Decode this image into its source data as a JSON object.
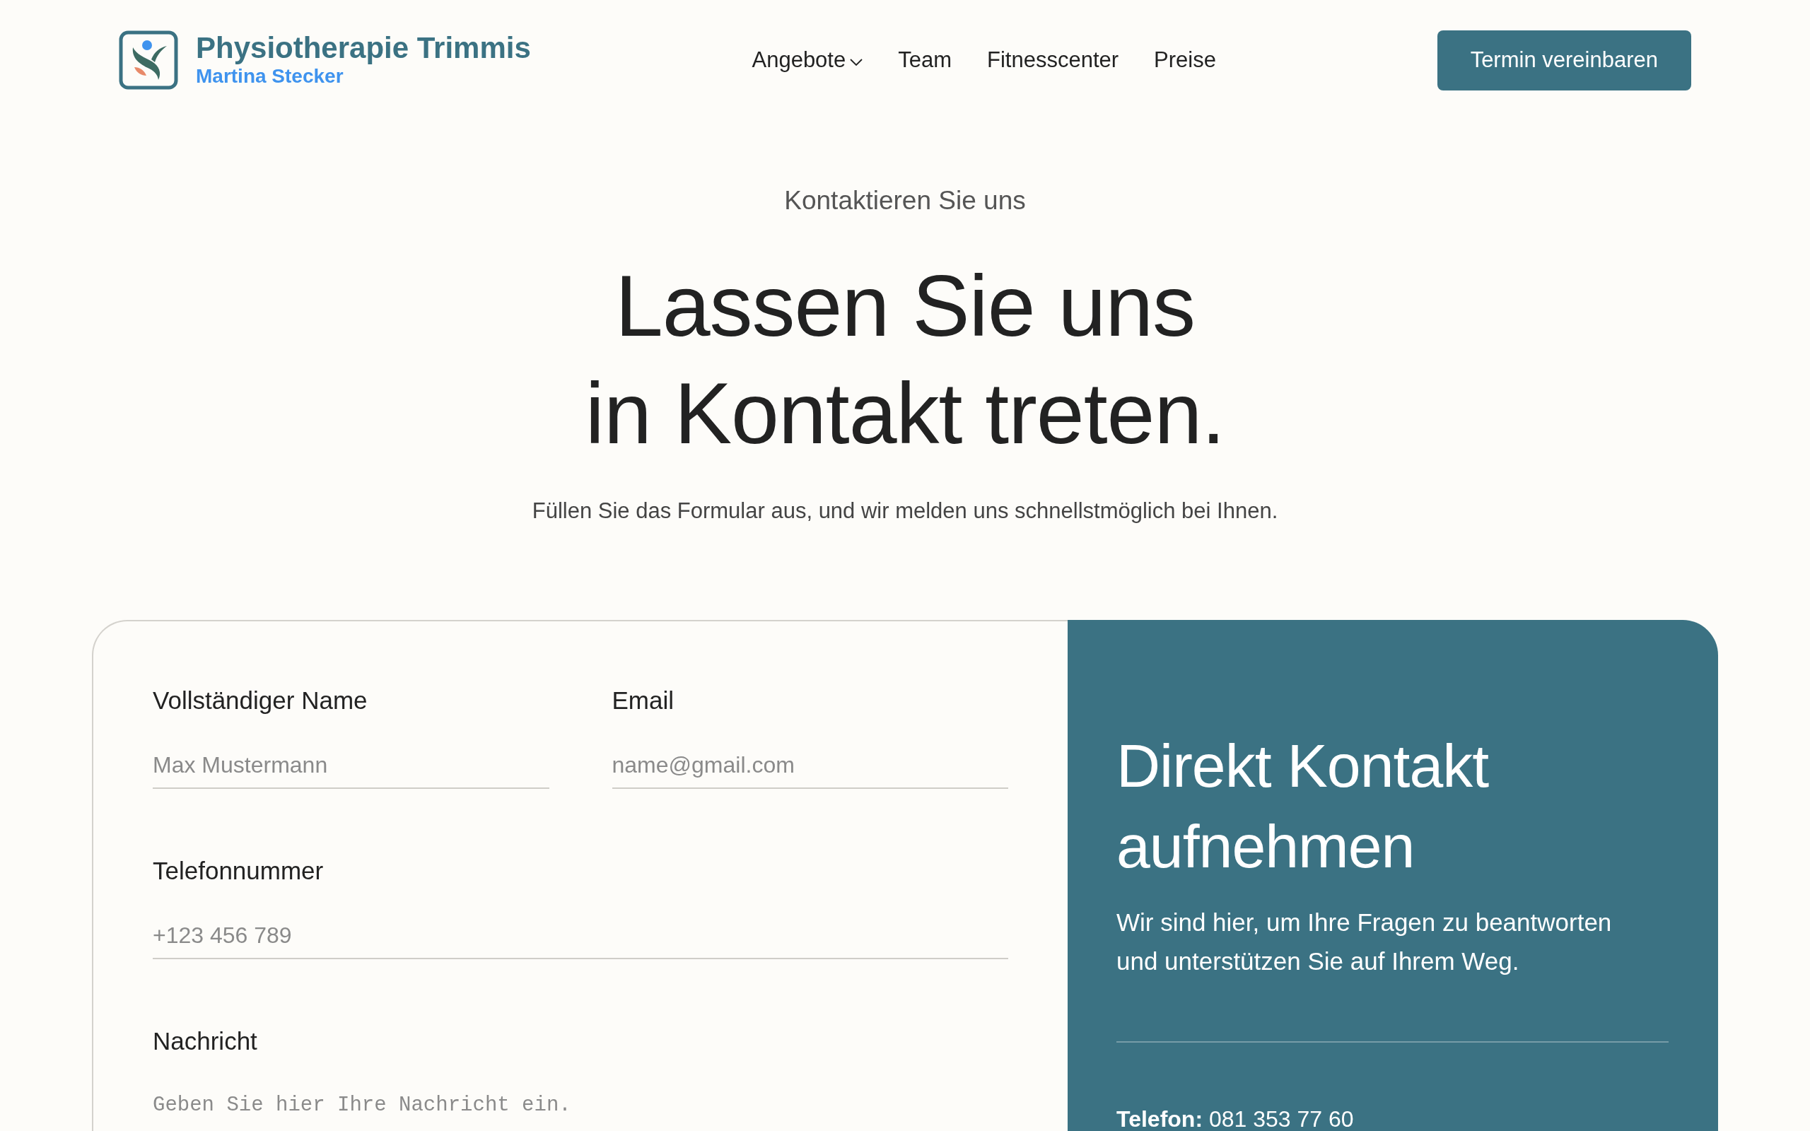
{
  "header": {
    "logo": {
      "title": "Physiotherapie Trimmis",
      "subtitle": "Martina Stecker"
    },
    "nav": [
      {
        "label": "Angebote",
        "has_menu": true
      },
      {
        "label": "Team",
        "has_menu": false
      },
      {
        "label": "Fitnesscenter",
        "has_menu": false
      },
      {
        "label": "Preise",
        "has_menu": false
      }
    ],
    "cta_button": "Termin vereinbaren"
  },
  "hero": {
    "kicker": "Kontaktieren Sie uns",
    "heading_lines": [
      "Lassen Sie uns",
      "in Kontakt treten."
    ],
    "subtitle": "Füllen Sie das Formular aus, und wir melden uns schnellstmöglich bei Ihnen."
  },
  "contact_form": {
    "rows": [
      {
        "fields": [
          {
            "label": "Vollständiger Name",
            "placeholder": "Max Mustermann",
            "kind": "input"
          },
          {
            "label": "Email",
            "placeholder": "name@gmail.com",
            "kind": "input"
          }
        ]
      },
      {
        "fields": [
          {
            "label": "Telefonnummer",
            "placeholder": "+123 456 789",
            "kind": "input"
          }
        ]
      },
      {
        "fields": [
          {
            "label": "Nachricht",
            "placeholder": "Geben Sie hier Ihre Nachricht ein.",
            "kind": "textarea"
          }
        ]
      }
    ]
  },
  "contact_panel": {
    "title": "Direkt Kontakt aufnehmen",
    "text": "Wir sind hier, um Ihre Fragen zu beantworten und unterstützen Sie auf Ihrem Weg.",
    "details": [
      "**Telefon:** 081 353 77 60"
    ]
  }
}
